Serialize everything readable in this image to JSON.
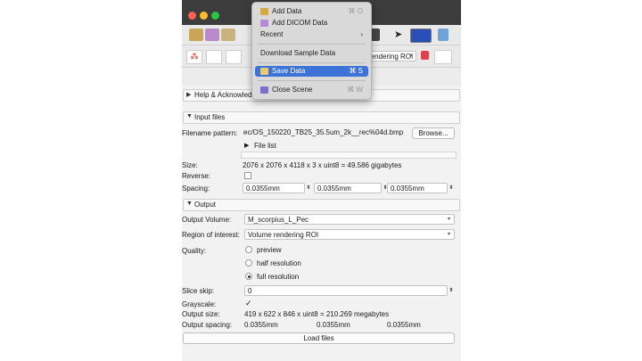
{
  "menu": {
    "add_data": {
      "label": "Add Data",
      "shortcut": "⌘ O"
    },
    "add_dicom": {
      "label": "Add DICOM Data",
      "shortcut": ""
    },
    "recent": {
      "label": "Recent",
      "arrow": "›"
    },
    "download_sample": {
      "label": "Download Sample Data"
    },
    "save_data": {
      "label": "Save Data",
      "shortcut": "⌘ S"
    },
    "close_scene": {
      "label": "Close Scene",
      "shortcut": "⌘ W"
    }
  },
  "toolbar": {
    "roi_selector": "rendering ROI"
  },
  "sections": {
    "help": "Help & Acknowledgment",
    "input": "Input files",
    "file_list": "File list",
    "output": "Output"
  },
  "input": {
    "filename_pattern_label": "Filename pattern:",
    "filename_pattern_value": "ec/OS_150220_TB25_35.5um_2k__rec%04d.bmp",
    "browse_label": "Browse...",
    "size_label": "Size:",
    "size_value": "2076 x 2076 x 4118 x 3 x uint8 = 49.586 gigabytes",
    "reverse_label": "Reverse:",
    "spacing_label": "Spacing:",
    "spacing_values": [
      "0.0355mm",
      "0.0355mm",
      "0.0355mm"
    ]
  },
  "output": {
    "volume_label": "Output Volume:",
    "volume_value": "M_scorpius_L_Pec",
    "roi_label": "Region of interest:",
    "roi_value": "Volume rendering ROI",
    "quality_label": "Quality:",
    "quality_options": [
      "preview",
      "half resolution",
      "full resolution"
    ],
    "quality_selected": "full resolution",
    "slice_skip_label": "Slice skip:",
    "slice_skip_value": "0",
    "grayscale_label": "Grayscale:",
    "grayscale_mark": "✓",
    "output_size_label": "Output size:",
    "output_size_value": "419 x 622 x 846 x uint8 = 210.269 megabytes",
    "output_spacing_label": "Output spacing:",
    "output_spacing_values": [
      "0.0355mm",
      "0.0355mm",
      "0.0355mm"
    ],
    "load_button": "Load files"
  },
  "colors": {
    "menu_highlight": "#3b73d8",
    "titlebar": "#3c3c3c"
  }
}
